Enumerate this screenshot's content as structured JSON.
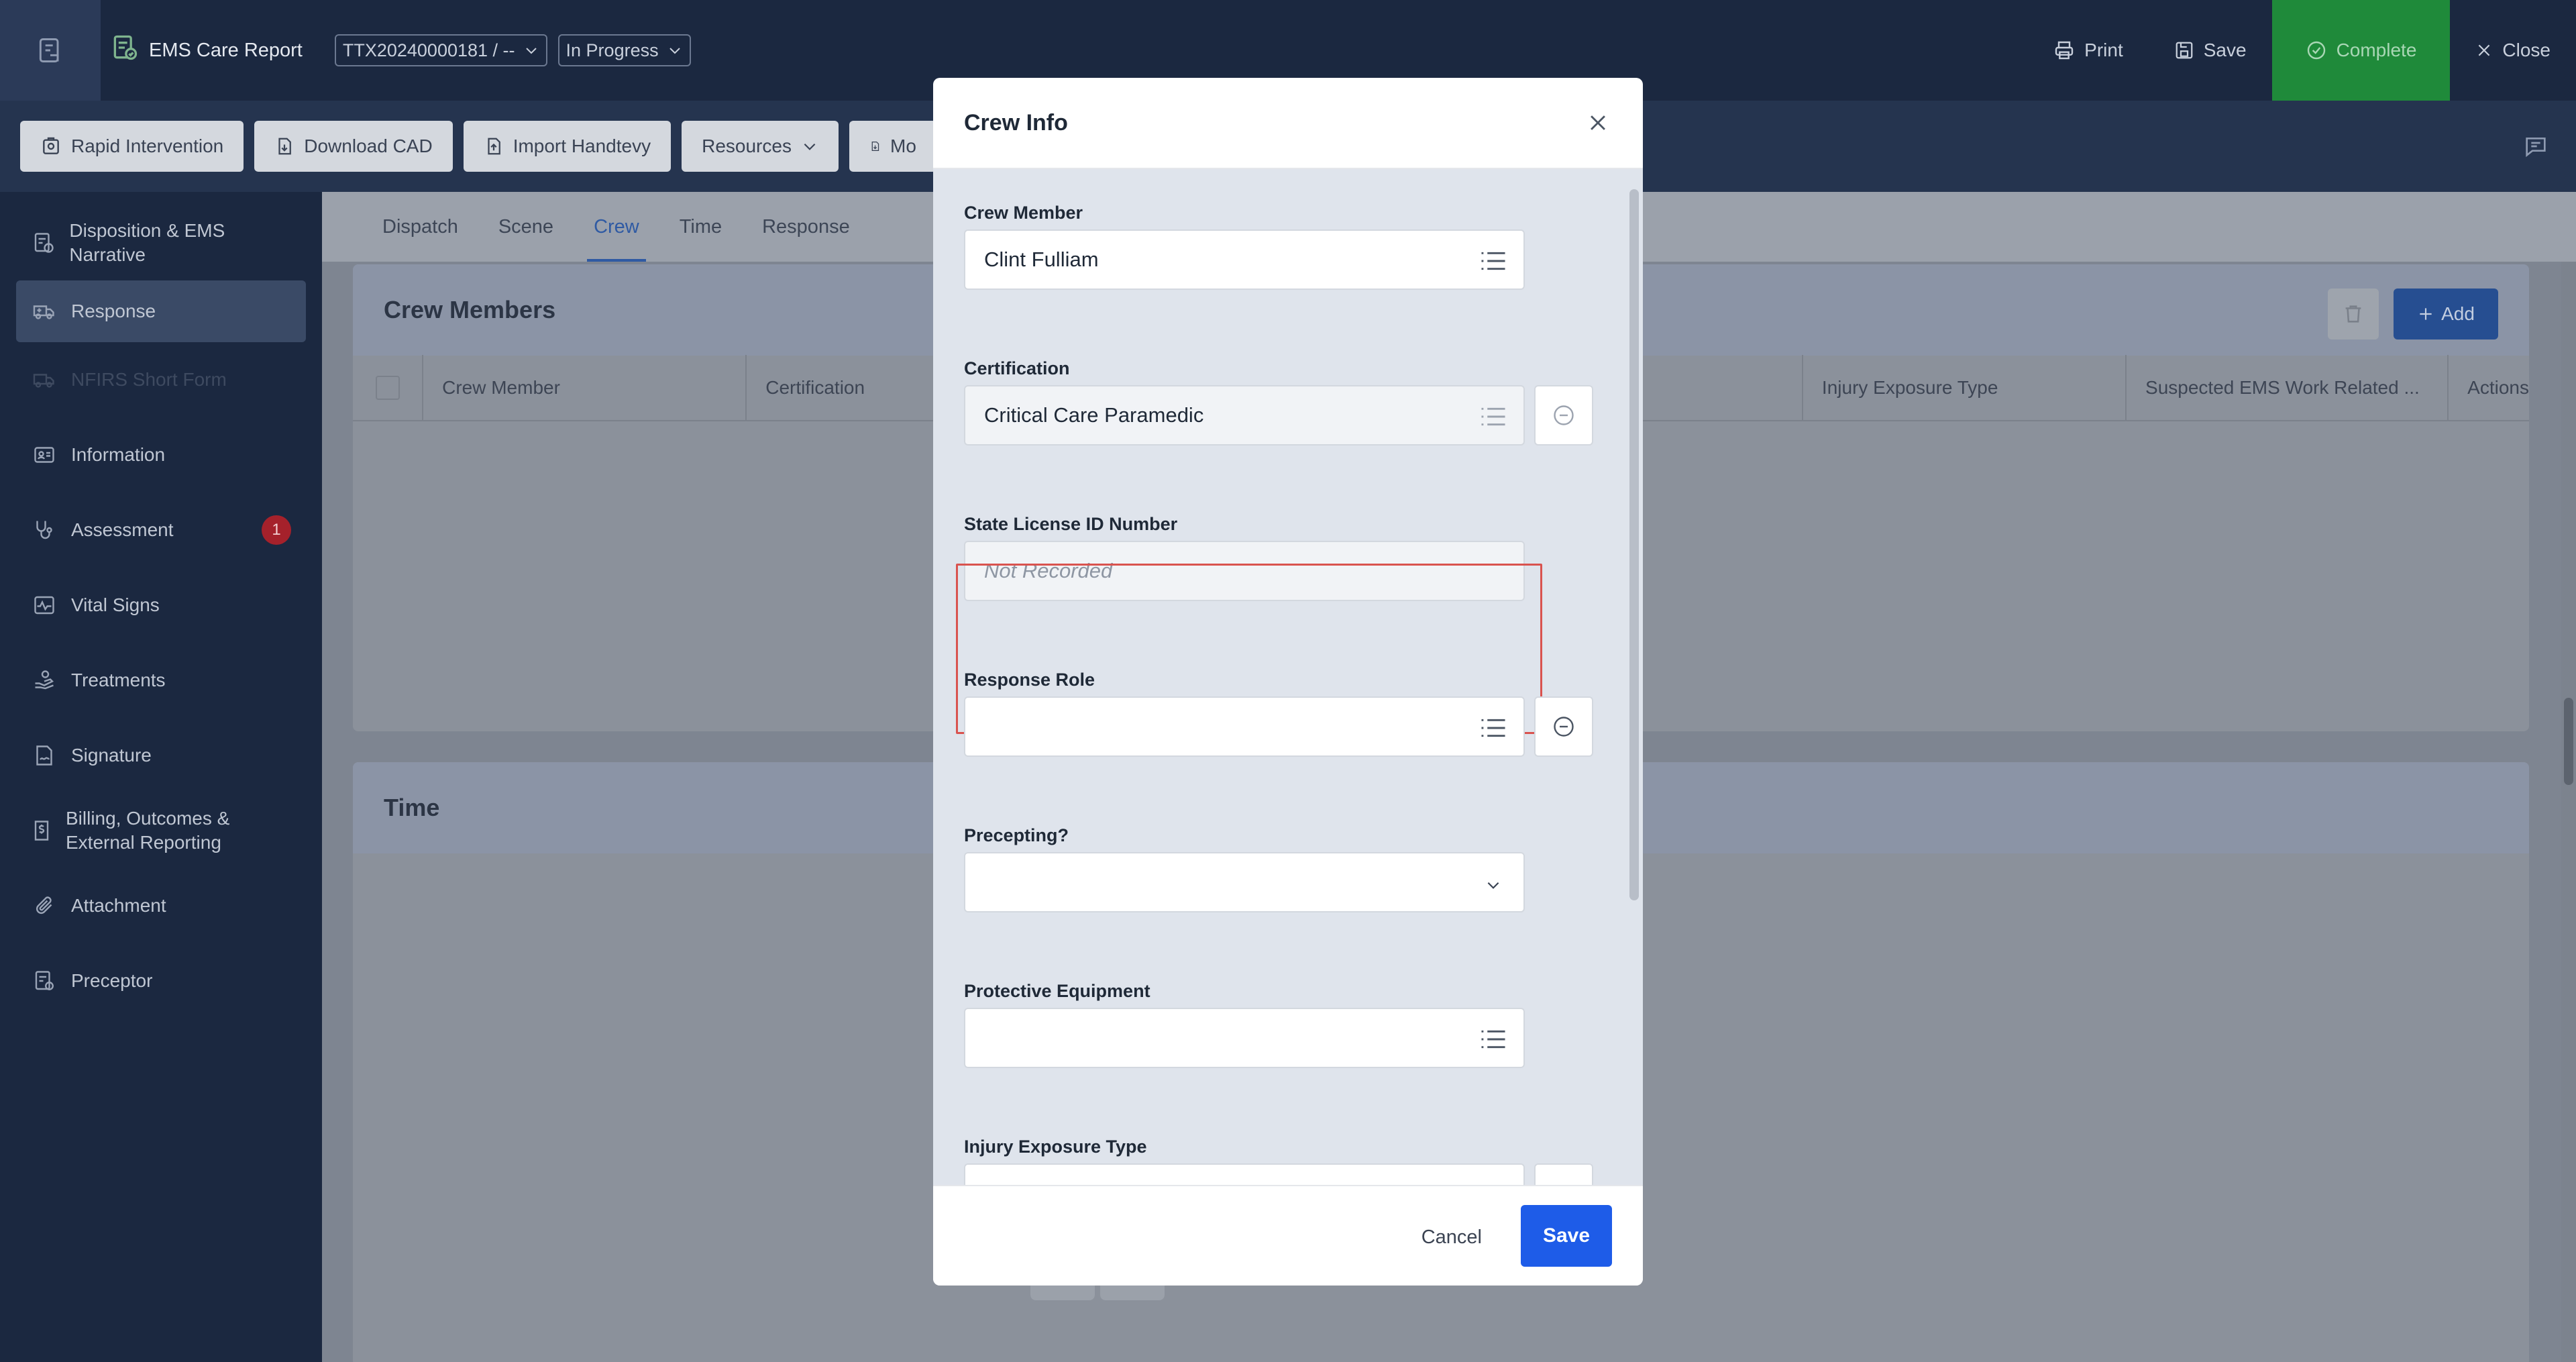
{
  "header": {
    "app_title": "EMS Care Report",
    "incident_id": "TTX20240000181 / --",
    "status": "In Progress",
    "actions": {
      "print": "Print",
      "save": "Save",
      "complete": "Complete",
      "close": "Close"
    }
  },
  "toolbar": {
    "rapid_intervention": "Rapid Intervention",
    "download_cad": "Download CAD",
    "import_handtevy": "Import Handtevy",
    "resources": "Resources",
    "more": "Mo"
  },
  "sidebar": {
    "items": [
      {
        "label": "Disposition & EMS Narrative",
        "icon": "disposition-icon"
      },
      {
        "label": "Response",
        "icon": "ambulance-icon"
      },
      {
        "label": "NFIRS Short Form",
        "icon": "truck-icon"
      },
      {
        "label": "Information",
        "icon": "id-card-icon"
      },
      {
        "label": "Assessment",
        "icon": "stethoscope-icon",
        "badge": "1"
      },
      {
        "label": "Vital Signs",
        "icon": "pulse-icon"
      },
      {
        "label": "Treatments",
        "icon": "hand-care-icon"
      },
      {
        "label": "Signature",
        "icon": "signature-icon"
      },
      {
        "label": "Billing, Outcomes & External Reporting",
        "icon": "billing-icon"
      },
      {
        "label": "Attachment",
        "icon": "paperclip-icon"
      },
      {
        "label": "Preceptor",
        "icon": "preceptor-icon"
      }
    ]
  },
  "tabs": [
    "Dispatch",
    "Scene",
    "Crew",
    "Time",
    "Response"
  ],
  "crew_panel": {
    "title": "Crew Members",
    "add_label": "Add",
    "columns": [
      "Crew Member",
      "Certification",
      "Injury Exposure Type",
      "Suspected EMS Work Related ...",
      "Actions"
    ]
  },
  "time_panel": {
    "title": "Time"
  },
  "modal": {
    "title": "Crew Info",
    "fields": {
      "crew_member": {
        "label": "Crew Member",
        "value": "Clint Fulliam"
      },
      "certification": {
        "label": "Certification",
        "value": "Critical Care Paramedic"
      },
      "state_license": {
        "label": "State License ID Number",
        "placeholder": "Not Recorded"
      },
      "response_role": {
        "label": "Response Role",
        "value": ""
      },
      "precepting": {
        "label": "Precepting?",
        "value": ""
      },
      "protective_equipment": {
        "label": "Protective Equipment",
        "value": ""
      },
      "injury_exposure": {
        "label": "Injury Exposure Type",
        "value": ""
      }
    },
    "cancel_label": "Cancel",
    "save_label": "Save"
  },
  "colors": {
    "header_bg": "#1b2840",
    "complete_green": "#1f8a3a",
    "primary_blue": "#1e5ce8",
    "highlight_red": "#d9534f",
    "badge_red": "#a5212b"
  }
}
